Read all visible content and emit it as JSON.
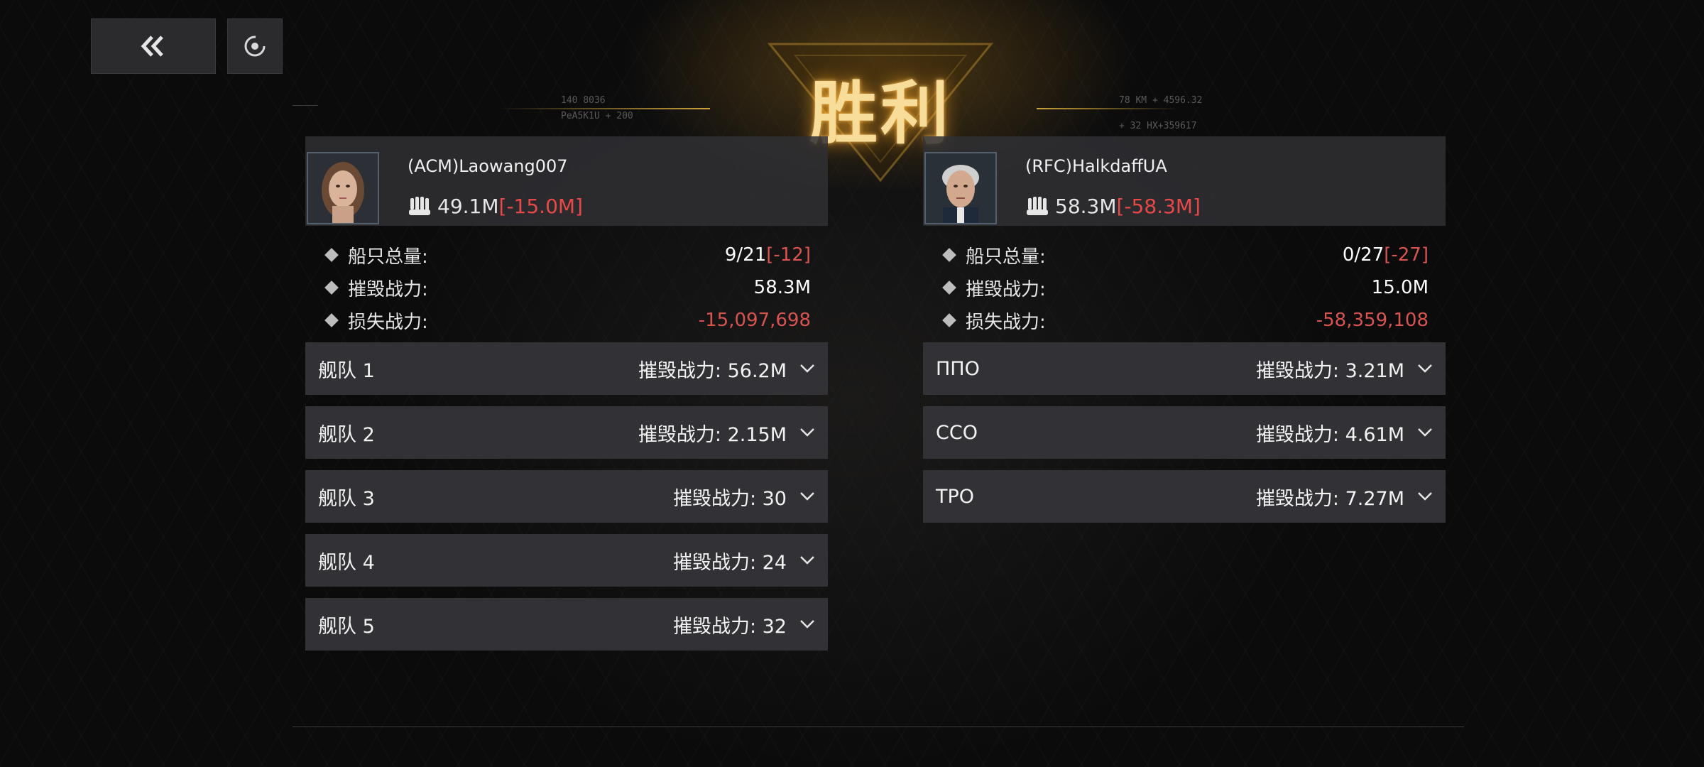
{
  "title": "胜利",
  "header_deco": {
    "left_text_1": "140  8036",
    "left_text_2": "PeA5K1U  +  200",
    "right_text_1": "78  KM  +  4596.32",
    "right_text_2": "+  32  HX+359617"
  },
  "left": {
    "player_name": "(ACM)Laowang007",
    "power": "49.1M",
    "power_delta": "[-15.0M]",
    "stats": [
      {
        "label": "船只总量:",
        "value": "9/21",
        "delta": "[-12]"
      },
      {
        "label": "摧毁战力:",
        "value": "58.3M",
        "delta": ""
      },
      {
        "label": "损失战力:",
        "value": "",
        "delta": "-15,097,698"
      }
    ],
    "fleets": [
      {
        "name": "舰队 1",
        "kill": "摧毁战力: 56.2M"
      },
      {
        "name": "舰队 2",
        "kill": "摧毁战力: 2.15M"
      },
      {
        "name": "舰队 3",
        "kill": "摧毁战力: 30"
      },
      {
        "name": "舰队 4",
        "kill": "摧毁战力: 24"
      },
      {
        "name": "舰队 5",
        "kill": "摧毁战力: 32"
      }
    ]
  },
  "right": {
    "player_name": "(RFC)HalkdaffUA",
    "power": "58.3M",
    "power_delta": "[-58.3M]",
    "stats": [
      {
        "label": "船只总量:",
        "value": "0/27",
        "delta": "[-27]"
      },
      {
        "label": "摧毁战力:",
        "value": "15.0M",
        "delta": ""
      },
      {
        "label": "损失战力:",
        "value": "",
        "delta": "-58,359,108"
      }
    ],
    "fleets": [
      {
        "name": "ППО",
        "kill": "摧毁战力: 3.21M"
      },
      {
        "name": "CCO",
        "kill": "摧毁战力: 4.61M"
      },
      {
        "name": "TPO",
        "kill": "摧毁战力: 7.27M"
      }
    ]
  },
  "colors": {
    "accent_gold": "#f7dc9a",
    "negative": "#e84848",
    "panel": "#323236"
  },
  "icons": {
    "back": "double-chevron-left-icon",
    "replay": "replay-icon",
    "power": "fist-icon",
    "expand": "chevron-down-icon"
  }
}
